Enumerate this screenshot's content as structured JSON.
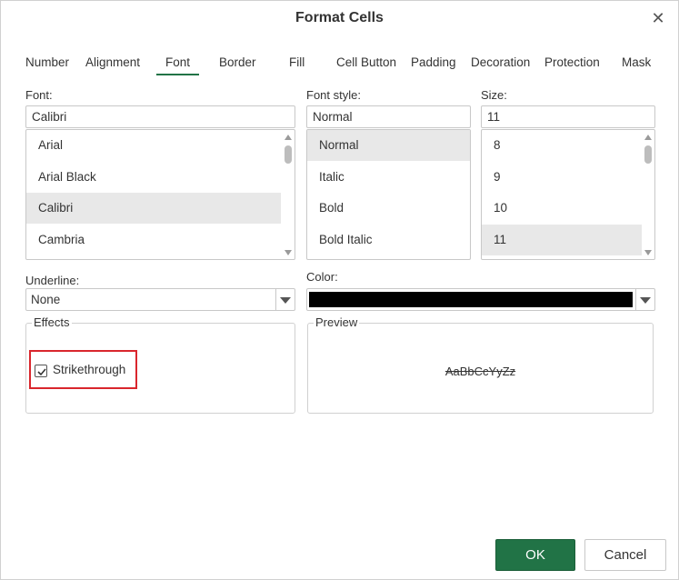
{
  "dialog": {
    "title": "Format Cells",
    "close_icon": "close-icon"
  },
  "tabs": [
    {
      "label": "Number"
    },
    {
      "label": "Alignment"
    },
    {
      "label": "Font",
      "active": true
    },
    {
      "label": "Border"
    },
    {
      "label": "Fill"
    },
    {
      "label": "Cell Button"
    },
    {
      "label": "Padding"
    },
    {
      "label": "Decoration"
    },
    {
      "label": "Protection"
    },
    {
      "label": "Mask"
    }
  ],
  "font": {
    "label": "Font:",
    "value": "Calibri",
    "items": [
      "Arial",
      "Arial Black",
      "Calibri",
      "Cambria"
    ],
    "selected": "Calibri"
  },
  "font_style": {
    "label": "Font style:",
    "value": "Normal",
    "items": [
      "Normal",
      "Italic",
      "Bold",
      "Bold Italic"
    ],
    "selected": "Normal"
  },
  "size": {
    "label": "Size:",
    "value": "11",
    "items": [
      "8",
      "9",
      "10",
      "11"
    ],
    "selected": "11"
  },
  "underline": {
    "label": "Underline:",
    "value": "None"
  },
  "color": {
    "label": "Color:",
    "value": "#000000"
  },
  "effects": {
    "legend": "Effects",
    "strikethrough_label": "Strikethrough",
    "strikethrough_checked": true
  },
  "preview": {
    "legend": "Preview",
    "text": "AaBbCcYyZz"
  },
  "buttons": {
    "ok": "OK",
    "cancel": "Cancel"
  },
  "colors": {
    "accent": "#217346",
    "highlight": "#d9262d"
  }
}
